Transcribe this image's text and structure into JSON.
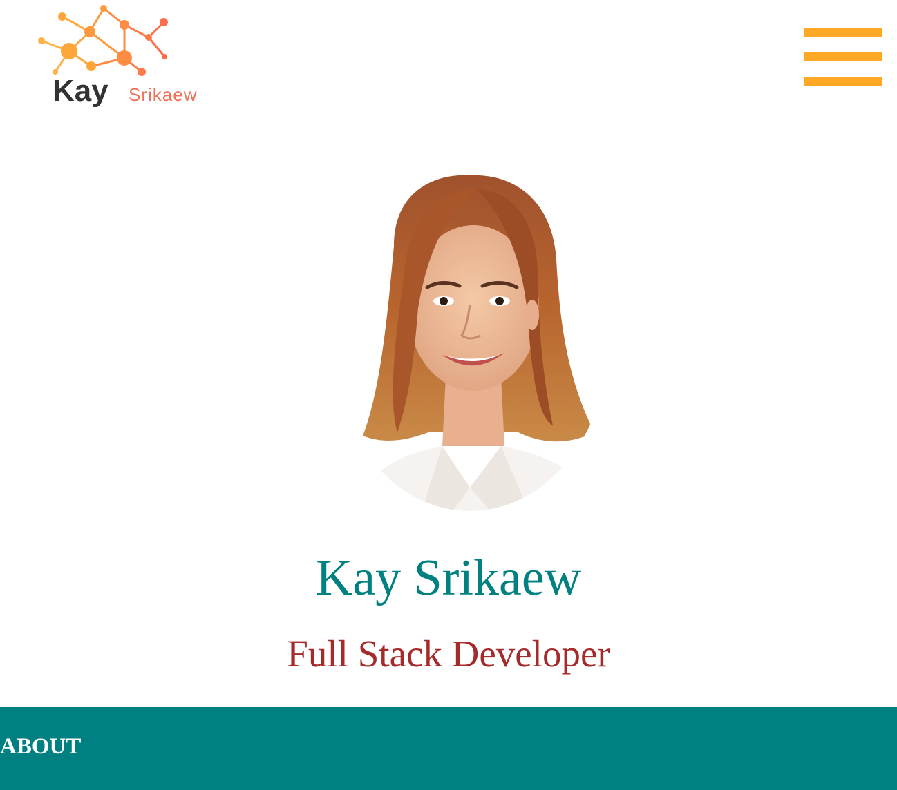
{
  "header": {
    "logo": {
      "first_name": "Kay",
      "last_name": "Srikaew",
      "icon": "molecule-network-icon"
    },
    "menu_icon": "hamburger-menu-icon"
  },
  "hero": {
    "name": "Kay Srikaew",
    "role": "Full Stack Developer",
    "portrait_icon": "profile-photo"
  },
  "about": {
    "heading": "ABOUT"
  },
  "colors": {
    "accent_orange": "#ffa825",
    "teal": "#008080",
    "brown_red": "#a52a2a",
    "logo_coral": "#f0705a",
    "logo_dark": "#333333"
  }
}
